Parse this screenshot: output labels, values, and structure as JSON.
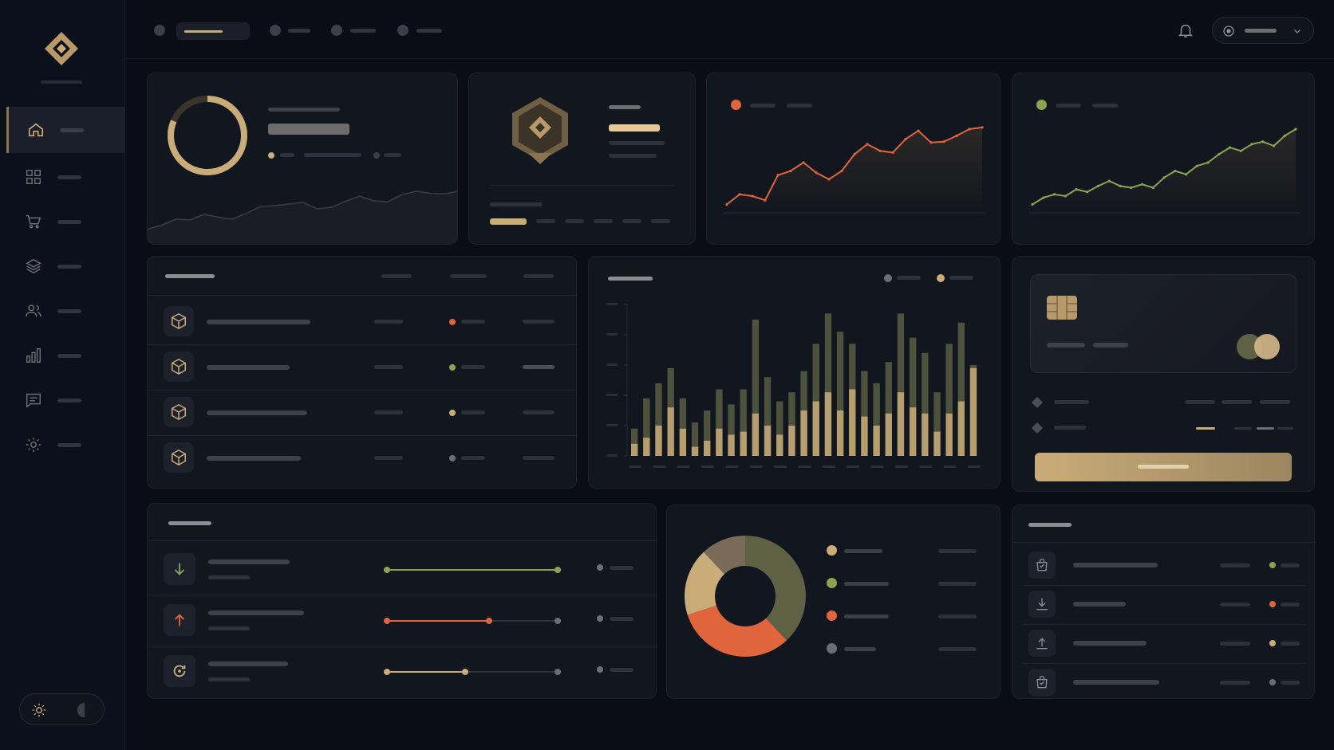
{
  "colors": {
    "gold": "#c9ac78",
    "orange": "#e0643c",
    "green": "#8aa552",
    "olive": "#5e6144",
    "grey": "#6b6e75",
    "bg": "#0a0d15",
    "card": "#12161f"
  },
  "sidebar": {
    "items": [
      {
        "icon": "home-icon",
        "active": true
      },
      {
        "icon": "grid-icon",
        "active": false
      },
      {
        "icon": "cart-icon",
        "active": false
      },
      {
        "icon": "layers-icon",
        "active": false
      },
      {
        "icon": "users-icon",
        "active": false
      },
      {
        "icon": "bar-chart-icon",
        "active": false
      },
      {
        "icon": "message-icon",
        "active": false
      },
      {
        "icon": "gear-icon",
        "active": false
      }
    ]
  },
  "topbar": {
    "icons": [
      "bell-icon",
      "user-icon",
      "chevron-down-icon"
    ]
  },
  "cards": {
    "progress_ring": {
      "icon": "ring-icon"
    },
    "badge": {
      "icon": "hexagon-badge-icon"
    },
    "sparkline_orange": {
      "icon": "orange-dot"
    },
    "sparkline_green": {
      "icon": "green-dot"
    },
    "product_table": {
      "row_icons": [
        "box-icon",
        "box-icon",
        "box-icon",
        "box-icon"
      ],
      "status_colors": [
        "#e0643c",
        "#8aa552",
        "#c9ac78",
        "#6b6e75"
      ]
    },
    "bar_chart": {},
    "credit_card": {
      "icons": [
        "chip-icon",
        "mastercard-icon"
      ]
    },
    "transfers": {
      "row_icons": [
        "arrow-down-icon",
        "arrow-up-icon",
        "refresh-icon"
      ]
    },
    "donut": {},
    "orders": {
      "row_icons": [
        "bag-icon",
        "download-icon",
        "upload-icon",
        "bag-icon"
      ],
      "status_colors": [
        "#8aa552",
        "#e0643c",
        "#c9ac78",
        "#6b6e75"
      ]
    }
  },
  "chart_data": [
    {
      "type": "area",
      "series": [
        {
          "values": [
            0.05,
            0.15,
            0.3,
            0.28,
            0.42,
            0.35,
            0.3,
            0.45,
            0.62,
            0.64,
            0.68,
            0.72,
            0.56,
            0.6,
            0.75,
            0.88,
            0.76,
            0.74,
            0.92,
            1.0,
            0.95,
            0.94,
            1.0
          ]
        }
      ]
    },
    {
      "type": "line",
      "series": [
        {
          "values": [
            0.1,
            0.22,
            0.2,
            0.15,
            0.45,
            0.5,
            0.6,
            0.48,
            0.4,
            0.5,
            0.7,
            0.82,
            0.74,
            0.72,
            0.88,
            0.98,
            0.84,
            0.85,
            0.92,
            1.0,
            1.02
          ]
        }
      ]
    },
    {
      "type": "line",
      "series": [
        {
          "values": [
            0.1,
            0.18,
            0.22,
            0.2,
            0.28,
            0.25,
            0.32,
            0.38,
            0.32,
            0.3,
            0.34,
            0.3,
            0.42,
            0.5,
            0.46,
            0.56,
            0.6,
            0.7,
            0.78,
            0.74,
            0.82,
            0.85,
            0.8,
            0.92,
            1.0
          ]
        }
      ]
    },
    {
      "type": "bar",
      "series": [
        {
          "name": "",
          "values": [
            0.18,
            0.38,
            0.48,
            0.58,
            0.38,
            0.22,
            0.3,
            0.44,
            0.34,
            0.44,
            0.9,
            0.52,
            0.36,
            0.42,
            0.56,
            0.74,
            0.94,
            0.82,
            0.74,
            0.56,
            0.48,
            0.62,
            0.94,
            0.78,
            0.68,
            0.42,
            0.74,
            0.88,
            0.6
          ]
        },
        {
          "name": "",
          "values": [
            0.08,
            0.12,
            0.2,
            0.32,
            0.18,
            0.06,
            0.1,
            0.18,
            0.14,
            0.16,
            0.28,
            0.2,
            0.14,
            0.2,
            0.3,
            0.36,
            0.42,
            0.3,
            0.44,
            0.26,
            0.2,
            0.28,
            0.42,
            0.32,
            0.28,
            0.16,
            0.28,
            0.36,
            0.58
          ]
        }
      ]
    },
    {
      "type": "pie",
      "series": [
        {
          "values": [
            0.38,
            0.32,
            0.18,
            0.12
          ]
        }
      ],
      "colors": [
        "#5e6144",
        "#e0643c",
        "#c9ac78",
        "#7a6b58"
      ]
    }
  ]
}
